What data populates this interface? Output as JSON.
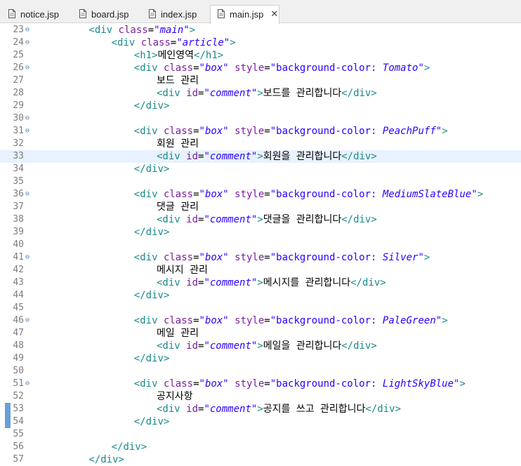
{
  "tabs": [
    {
      "label": "notice.jsp",
      "active": false
    },
    {
      "label": "board.jsp",
      "active": false
    },
    {
      "label": "index.jsp",
      "active": false
    },
    {
      "label": "main.jsp",
      "active": true
    }
  ],
  "close_symbol": "✕",
  "editor": {
    "current_line": 33,
    "lines": [
      {
        "n": "23",
        "fold": "⊖",
        "indent": 8,
        "tokens": [
          [
            "tag",
            "<div "
          ],
          [
            "attr",
            "class"
          ],
          [
            "txt",
            "="
          ],
          [
            "val",
            "\"main\""
          ],
          [
            "tag",
            ">"
          ]
        ]
      },
      {
        "n": "24",
        "fold": "⊖",
        "indent": 12,
        "tokens": [
          [
            "tag",
            "<div "
          ],
          [
            "attr",
            "class"
          ],
          [
            "txt",
            "="
          ],
          [
            "val",
            "\"article\""
          ],
          [
            "tag",
            ">"
          ]
        ]
      },
      {
        "n": "25",
        "fold": "",
        "indent": 16,
        "tokens": [
          [
            "tag",
            "<h1>"
          ],
          [
            "txt",
            "메인영역"
          ],
          [
            "tag",
            "</h1>"
          ]
        ]
      },
      {
        "n": "26",
        "fold": "⊖",
        "indent": 16,
        "tokens": [
          [
            "tag",
            "<div "
          ],
          [
            "attr",
            "class"
          ],
          [
            "txt",
            "="
          ],
          [
            "val",
            "\"box\""
          ],
          [
            "txt",
            " "
          ],
          [
            "attr",
            "style"
          ],
          [
            "txt",
            "="
          ],
          [
            "str",
            "\"background-color: "
          ],
          [
            "css-val",
            "Tomato"
          ],
          [
            "str",
            "\""
          ],
          [
            "tag",
            ">"
          ]
        ]
      },
      {
        "n": "27",
        "fold": "",
        "indent": 20,
        "tokens": [
          [
            "txt",
            "보드 관리"
          ]
        ]
      },
      {
        "n": "28",
        "fold": "",
        "indent": 20,
        "tokens": [
          [
            "tag",
            "<div "
          ],
          [
            "attr",
            "id"
          ],
          [
            "txt",
            "="
          ],
          [
            "val",
            "\"comment\""
          ],
          [
            "tag",
            ">"
          ],
          [
            "txt",
            "보드를 관리합니다"
          ],
          [
            "tag",
            "</div>"
          ]
        ]
      },
      {
        "n": "29",
        "fold": "",
        "indent": 16,
        "tokens": [
          [
            "tag",
            "</div>"
          ]
        ]
      },
      {
        "n": "30",
        "fold": "⊖",
        "indent": 0,
        "tokens": []
      },
      {
        "n": "31",
        "fold": "⊖",
        "indent": 16,
        "tokens": [
          [
            "tag",
            "<div "
          ],
          [
            "attr",
            "class"
          ],
          [
            "txt",
            "="
          ],
          [
            "val",
            "\"box\""
          ],
          [
            "txt",
            " "
          ],
          [
            "attr",
            "style"
          ],
          [
            "txt",
            "="
          ],
          [
            "str",
            "\"background-color: "
          ],
          [
            "css-val",
            "PeachPuff"
          ],
          [
            "str",
            "\""
          ],
          [
            "tag",
            ">"
          ]
        ]
      },
      {
        "n": "32",
        "fold": "",
        "indent": 20,
        "tokens": [
          [
            "txt",
            "회원 관리"
          ]
        ]
      },
      {
        "n": "33",
        "fold": "",
        "indent": 20,
        "tokens": [
          [
            "tag",
            "<div "
          ],
          [
            "attr",
            "id"
          ],
          [
            "txt",
            "="
          ],
          [
            "val",
            "\"comment\""
          ],
          [
            "tag",
            ">"
          ],
          [
            "txt",
            "회원을 관리합니다"
          ],
          [
            "tag",
            "</div>"
          ]
        ]
      },
      {
        "n": "34",
        "fold": "",
        "indent": 16,
        "tokens": [
          [
            "tag",
            "</div>"
          ]
        ]
      },
      {
        "n": "35",
        "fold": "",
        "indent": 0,
        "tokens": []
      },
      {
        "n": "36",
        "fold": "⊖",
        "indent": 16,
        "tokens": [
          [
            "tag",
            "<div "
          ],
          [
            "attr",
            "class"
          ],
          [
            "txt",
            "="
          ],
          [
            "val",
            "\"box\""
          ],
          [
            "txt",
            " "
          ],
          [
            "attr",
            "style"
          ],
          [
            "txt",
            "="
          ],
          [
            "str",
            "\"background-color: "
          ],
          [
            "css-val",
            "MediumSlateBlue"
          ],
          [
            "str",
            "\""
          ],
          [
            "tag",
            ">"
          ]
        ]
      },
      {
        "n": "37",
        "fold": "",
        "indent": 20,
        "tokens": [
          [
            "txt",
            "댓글 관리"
          ]
        ]
      },
      {
        "n": "38",
        "fold": "",
        "indent": 20,
        "tokens": [
          [
            "tag",
            "<div "
          ],
          [
            "attr",
            "id"
          ],
          [
            "txt",
            "="
          ],
          [
            "val",
            "\"comment\""
          ],
          [
            "tag",
            ">"
          ],
          [
            "txt",
            "댓글을 관리합니다"
          ],
          [
            "tag",
            "</div>"
          ]
        ]
      },
      {
        "n": "39",
        "fold": "",
        "indent": 16,
        "tokens": [
          [
            "tag",
            "</div>"
          ]
        ]
      },
      {
        "n": "40",
        "fold": "",
        "indent": 0,
        "tokens": []
      },
      {
        "n": "41",
        "fold": "⊖",
        "indent": 16,
        "tokens": [
          [
            "tag",
            "<div "
          ],
          [
            "attr",
            "class"
          ],
          [
            "txt",
            "="
          ],
          [
            "val",
            "\"box\""
          ],
          [
            "txt",
            " "
          ],
          [
            "attr",
            "style"
          ],
          [
            "txt",
            "="
          ],
          [
            "str",
            "\"background-color: "
          ],
          [
            "css-val",
            "Silver"
          ],
          [
            "str",
            "\""
          ],
          [
            "tag",
            ">"
          ]
        ]
      },
      {
        "n": "42",
        "fold": "",
        "indent": 20,
        "tokens": [
          [
            "txt",
            "메시지 관리"
          ]
        ]
      },
      {
        "n": "43",
        "fold": "",
        "indent": 20,
        "tokens": [
          [
            "tag",
            "<div "
          ],
          [
            "attr",
            "id"
          ],
          [
            "txt",
            "="
          ],
          [
            "val",
            "\"comment\""
          ],
          [
            "tag",
            ">"
          ],
          [
            "txt",
            "메시지를 관리합니다"
          ],
          [
            "tag",
            "</div>"
          ]
        ]
      },
      {
        "n": "44",
        "fold": "",
        "indent": 16,
        "tokens": [
          [
            "tag",
            "</div>"
          ]
        ]
      },
      {
        "n": "45",
        "fold": "",
        "indent": 0,
        "tokens": []
      },
      {
        "n": "46",
        "fold": "⊖",
        "indent": 16,
        "tokens": [
          [
            "tag",
            "<div "
          ],
          [
            "attr",
            "class"
          ],
          [
            "txt",
            "="
          ],
          [
            "val",
            "\"box\""
          ],
          [
            "txt",
            " "
          ],
          [
            "attr",
            "style"
          ],
          [
            "txt",
            "="
          ],
          [
            "str",
            "\"background-color: "
          ],
          [
            "css-val",
            "PaleGreen"
          ],
          [
            "str",
            "\""
          ],
          [
            "tag",
            ">"
          ]
        ]
      },
      {
        "n": "47",
        "fold": "",
        "indent": 20,
        "tokens": [
          [
            "txt",
            "메일 관리"
          ]
        ]
      },
      {
        "n": "48",
        "fold": "",
        "indent": 20,
        "tokens": [
          [
            "tag",
            "<div "
          ],
          [
            "attr",
            "id"
          ],
          [
            "txt",
            "="
          ],
          [
            "val",
            "\"comment\""
          ],
          [
            "tag",
            ">"
          ],
          [
            "txt",
            "메일을 관리합니다"
          ],
          [
            "tag",
            "</div>"
          ]
        ]
      },
      {
        "n": "49",
        "fold": "",
        "indent": 16,
        "tokens": [
          [
            "tag",
            "</div>"
          ]
        ]
      },
      {
        "n": "50",
        "fold": "",
        "indent": 0,
        "tokens": []
      },
      {
        "n": "51",
        "fold": "⊖",
        "indent": 16,
        "tokens": [
          [
            "tag",
            "<div "
          ],
          [
            "attr",
            "class"
          ],
          [
            "txt",
            "="
          ],
          [
            "val",
            "\"box\""
          ],
          [
            "txt",
            " "
          ],
          [
            "attr",
            "style"
          ],
          [
            "txt",
            "="
          ],
          [
            "str",
            "\"background-color: "
          ],
          [
            "css-val",
            "LightSkyBlue"
          ],
          [
            "str",
            "\""
          ],
          [
            "tag",
            ">"
          ]
        ]
      },
      {
        "n": "52",
        "fold": "",
        "indent": 20,
        "tokens": [
          [
            "txt",
            "공지사항"
          ]
        ]
      },
      {
        "n": "53",
        "fold": "",
        "indent": 20,
        "tokens": [
          [
            "tag",
            "<div "
          ],
          [
            "attr",
            "id"
          ],
          [
            "txt",
            "="
          ],
          [
            "val",
            "\"comment\""
          ],
          [
            "tag",
            ">"
          ],
          [
            "txt",
            "공지를 쓰고 관리합니다"
          ],
          [
            "tag",
            "</div>"
          ]
        ]
      },
      {
        "n": "54",
        "fold": "",
        "indent": 16,
        "tokens": [
          [
            "tag",
            "</div>"
          ]
        ]
      },
      {
        "n": "55",
        "fold": "",
        "indent": 0,
        "tokens": []
      },
      {
        "n": "56",
        "fold": "",
        "indent": 12,
        "tokens": [
          [
            "tag",
            "</div>"
          ]
        ]
      },
      {
        "n": "57",
        "fold": "",
        "indent": 8,
        "tokens": [
          [
            "tag",
            "</div>"
          ]
        ]
      }
    ]
  }
}
